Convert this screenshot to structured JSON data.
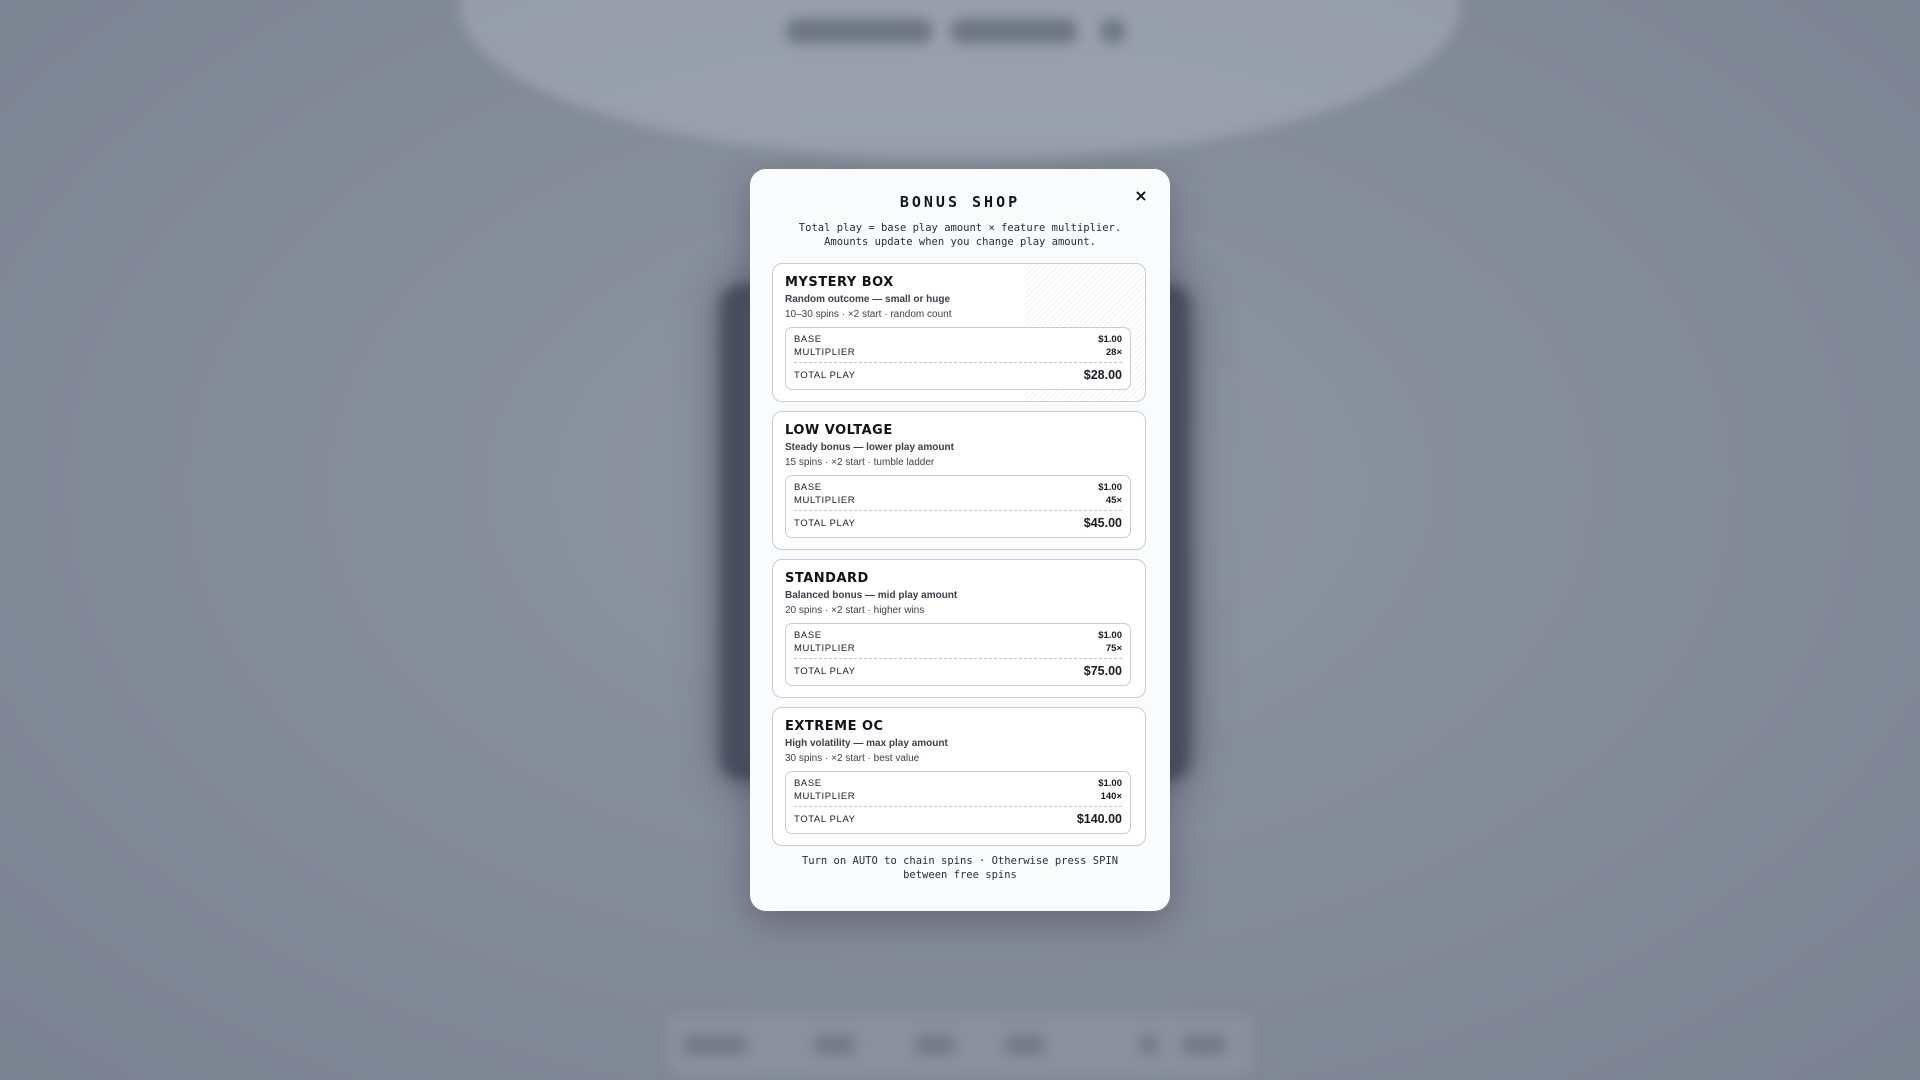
{
  "modal": {
    "title": "BONUS SHOP",
    "close_label": "×",
    "subtitle_line1": "Total play = base play amount × feature multiplier.",
    "subtitle_line2": "Amounts update when you change play amount.",
    "footer_line1": "Turn on AUTO to chain spins · Otherwise press SPIN",
    "footer_line2": "between free spins"
  },
  "labels": {
    "base": "BASE",
    "multiplier": "MULTIPLIER",
    "total_play": "TOTAL PLAY"
  },
  "bonuses": [
    {
      "name": "MYSTERY BOX",
      "description": "Random outcome — small or huge",
      "meta": "10–30 spins · ×2 start · random count",
      "base": "$1.00",
      "multiplier": "28×",
      "total": "$28.00"
    },
    {
      "name": "LOW VOLTAGE",
      "description": "Steady bonus — lower play amount",
      "meta": "15 spins · ×2 start · tumble ladder",
      "base": "$1.00",
      "multiplier": "45×",
      "total": "$45.00"
    },
    {
      "name": "STANDARD",
      "description": "Balanced bonus — mid play amount",
      "meta": "20 spins · ×2 start · higher wins",
      "base": "$1.00",
      "multiplier": "75×",
      "total": "$75.00"
    },
    {
      "name": "EXTREME OC",
      "description": "High volatility — max play amount",
      "meta": "30 spins · ×2 start · best value",
      "base": "$1.00",
      "multiplier": "140×",
      "total": "$140.00"
    }
  ]
}
